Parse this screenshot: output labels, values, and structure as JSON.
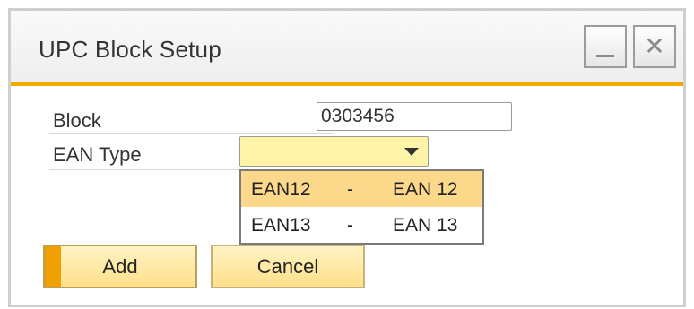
{
  "window": {
    "title": "UPC Block Setup",
    "accent_color": "#f0ab00",
    "controls": {
      "minimize_icon": "minimize-icon",
      "close_icon": "close-icon",
      "close_glyph": "✕"
    }
  },
  "form": {
    "block_label": "Block",
    "block_value": "0303456",
    "ean_type_label": "EAN Type",
    "ean_type_value": "",
    "ean_type_options": [
      {
        "code": "EAN12",
        "separator": "-",
        "description": "EAN 12",
        "highlighted": true
      },
      {
        "code": "EAN13",
        "separator": "-",
        "description": "EAN 13",
        "highlighted": false
      }
    ]
  },
  "buttons": {
    "add_label": "Add",
    "cancel_label": "Cancel"
  }
}
